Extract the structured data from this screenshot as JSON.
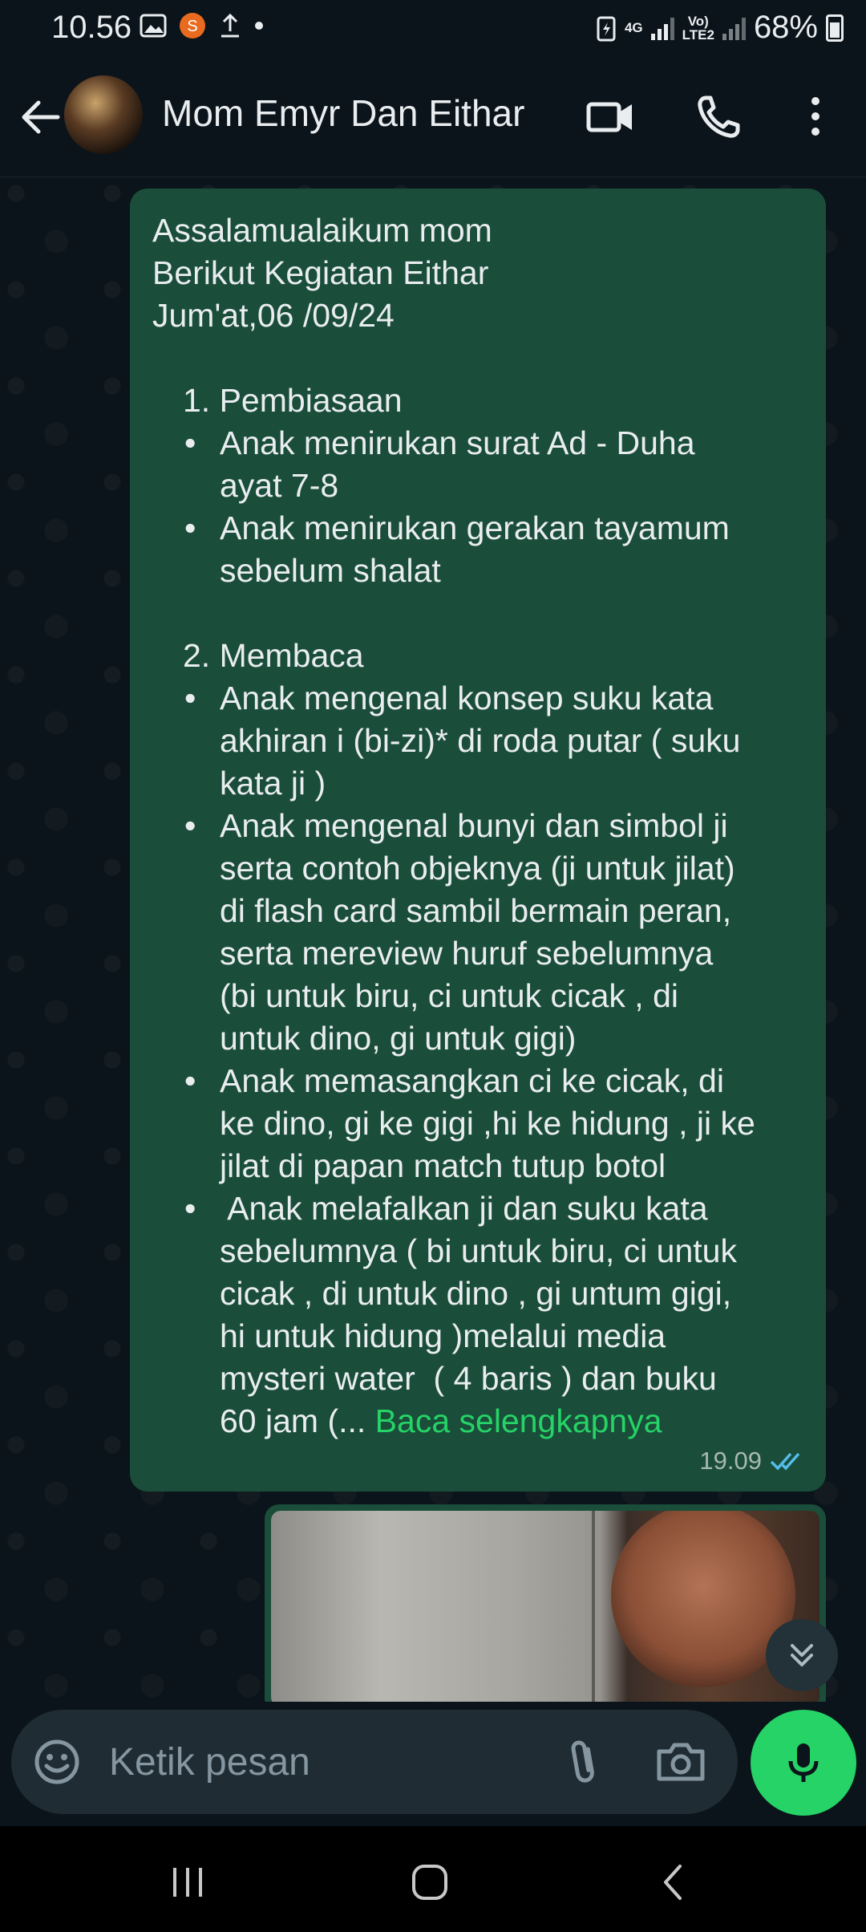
{
  "status_bar": {
    "time": "10.56",
    "network_1": "4G",
    "network_2_top": "Vo)",
    "network_2_bottom": "LTE2",
    "battery": "68%"
  },
  "header": {
    "title": "Mom Emyr Dan Eithar",
    "icons": [
      "back-arrow-icon",
      "video-call-icon",
      "voice-call-icon",
      "more-options-icon"
    ]
  },
  "message": {
    "lines": [
      "Assalamualaikum mom",
      "Berikut Kegiatan Eithar",
      "Jum'at,06 /09/24"
    ],
    "section1_title": "1. Pembiasaan",
    "section1_items": [
      [
        "Anak menirukan surat Ad - Duha",
        "ayat 7-8"
      ],
      [
        "Anak menirukan gerakan tayamum",
        "sebelum shalat"
      ]
    ],
    "section2_title": "2. Membaca",
    "section2_items": [
      [
        "Anak mengenal konsep suku kata",
        "akhiran i (bi-zi)* di roda putar ( suku",
        "kata ji )"
      ],
      [
        "Anak mengenal bunyi dan simbol ji",
        "serta contoh objeknya (ji untuk jilat)",
        "di flash card sambil bermain peran,",
        "serta mereview huruf sebelumnya",
        "(bi untuk biru, ci untuk cicak , di",
        "untuk dino, gi untuk gigi)"
      ],
      [
        "Anak memasangkan ci ke cicak, di",
        "ke dino, gi ke gigi ,hi ke hidung , ji ke",
        "jilat di papan match tutup botol"
      ],
      [
        " Anak melafalkan ji dan suku kata",
        "sebelumnya ( bi untuk biru, ci untuk",
        "cicak , di untuk dino , gi untum gigi,",
        "hi untuk hidung )melalui media",
        "mysteri water  ( 4 baris ) dan buku"
      ]
    ],
    "last_line": "60 jam (... ",
    "read_more": "Baca selengkapnya",
    "time": "19.09",
    "bullet": "•"
  },
  "input": {
    "placeholder": "Ketik pesan"
  },
  "colors": {
    "bubble": "#1a4d3a",
    "accent": "#25d366",
    "tick": "#53bdeb"
  }
}
